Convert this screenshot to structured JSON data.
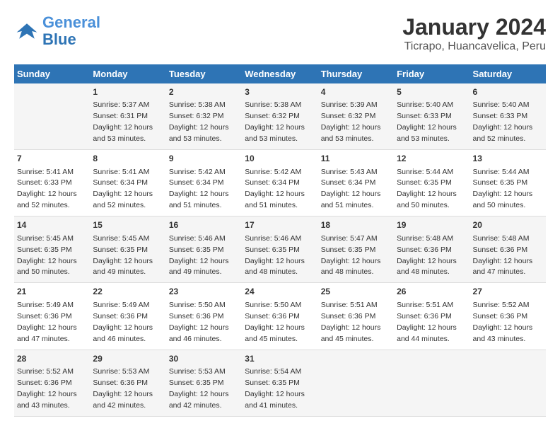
{
  "header": {
    "logo_line1": "General",
    "logo_line2": "Blue",
    "month_year": "January 2024",
    "location": "Ticrapo, Huancavelica, Peru"
  },
  "weekdays": [
    "Sunday",
    "Monday",
    "Tuesday",
    "Wednesday",
    "Thursday",
    "Friday",
    "Saturday"
  ],
  "weeks": [
    [
      {
        "day": "",
        "detail": ""
      },
      {
        "day": "1",
        "detail": "Sunrise: 5:37 AM\nSunset: 6:31 PM\nDaylight: 12 hours\nand 53 minutes."
      },
      {
        "day": "2",
        "detail": "Sunrise: 5:38 AM\nSunset: 6:32 PM\nDaylight: 12 hours\nand 53 minutes."
      },
      {
        "day": "3",
        "detail": "Sunrise: 5:38 AM\nSunset: 6:32 PM\nDaylight: 12 hours\nand 53 minutes."
      },
      {
        "day": "4",
        "detail": "Sunrise: 5:39 AM\nSunset: 6:32 PM\nDaylight: 12 hours\nand 53 minutes."
      },
      {
        "day": "5",
        "detail": "Sunrise: 5:40 AM\nSunset: 6:33 PM\nDaylight: 12 hours\nand 53 minutes."
      },
      {
        "day": "6",
        "detail": "Sunrise: 5:40 AM\nSunset: 6:33 PM\nDaylight: 12 hours\nand 52 minutes."
      }
    ],
    [
      {
        "day": "7",
        "detail": "Sunrise: 5:41 AM\nSunset: 6:33 PM\nDaylight: 12 hours\nand 52 minutes."
      },
      {
        "day": "8",
        "detail": "Sunrise: 5:41 AM\nSunset: 6:34 PM\nDaylight: 12 hours\nand 52 minutes."
      },
      {
        "day": "9",
        "detail": "Sunrise: 5:42 AM\nSunset: 6:34 PM\nDaylight: 12 hours\nand 51 minutes."
      },
      {
        "day": "10",
        "detail": "Sunrise: 5:42 AM\nSunset: 6:34 PM\nDaylight: 12 hours\nand 51 minutes."
      },
      {
        "day": "11",
        "detail": "Sunrise: 5:43 AM\nSunset: 6:34 PM\nDaylight: 12 hours\nand 51 minutes."
      },
      {
        "day": "12",
        "detail": "Sunrise: 5:44 AM\nSunset: 6:35 PM\nDaylight: 12 hours\nand 50 minutes."
      },
      {
        "day": "13",
        "detail": "Sunrise: 5:44 AM\nSunset: 6:35 PM\nDaylight: 12 hours\nand 50 minutes."
      }
    ],
    [
      {
        "day": "14",
        "detail": "Sunrise: 5:45 AM\nSunset: 6:35 PM\nDaylight: 12 hours\nand 50 minutes."
      },
      {
        "day": "15",
        "detail": "Sunrise: 5:45 AM\nSunset: 6:35 PM\nDaylight: 12 hours\nand 49 minutes."
      },
      {
        "day": "16",
        "detail": "Sunrise: 5:46 AM\nSunset: 6:35 PM\nDaylight: 12 hours\nand 49 minutes."
      },
      {
        "day": "17",
        "detail": "Sunrise: 5:46 AM\nSunset: 6:35 PM\nDaylight: 12 hours\nand 48 minutes."
      },
      {
        "day": "18",
        "detail": "Sunrise: 5:47 AM\nSunset: 6:35 PM\nDaylight: 12 hours\nand 48 minutes."
      },
      {
        "day": "19",
        "detail": "Sunrise: 5:48 AM\nSunset: 6:36 PM\nDaylight: 12 hours\nand 48 minutes."
      },
      {
        "day": "20",
        "detail": "Sunrise: 5:48 AM\nSunset: 6:36 PM\nDaylight: 12 hours\nand 47 minutes."
      }
    ],
    [
      {
        "day": "21",
        "detail": "Sunrise: 5:49 AM\nSunset: 6:36 PM\nDaylight: 12 hours\nand 47 minutes."
      },
      {
        "day": "22",
        "detail": "Sunrise: 5:49 AM\nSunset: 6:36 PM\nDaylight: 12 hours\nand 46 minutes."
      },
      {
        "day": "23",
        "detail": "Sunrise: 5:50 AM\nSunset: 6:36 PM\nDaylight: 12 hours\nand 46 minutes."
      },
      {
        "day": "24",
        "detail": "Sunrise: 5:50 AM\nSunset: 6:36 PM\nDaylight: 12 hours\nand 45 minutes."
      },
      {
        "day": "25",
        "detail": "Sunrise: 5:51 AM\nSunset: 6:36 PM\nDaylight: 12 hours\nand 45 minutes."
      },
      {
        "day": "26",
        "detail": "Sunrise: 5:51 AM\nSunset: 6:36 PM\nDaylight: 12 hours\nand 44 minutes."
      },
      {
        "day": "27",
        "detail": "Sunrise: 5:52 AM\nSunset: 6:36 PM\nDaylight: 12 hours\nand 43 minutes."
      }
    ],
    [
      {
        "day": "28",
        "detail": "Sunrise: 5:52 AM\nSunset: 6:36 PM\nDaylight: 12 hours\nand 43 minutes."
      },
      {
        "day": "29",
        "detail": "Sunrise: 5:53 AM\nSunset: 6:36 PM\nDaylight: 12 hours\nand 42 minutes."
      },
      {
        "day": "30",
        "detail": "Sunrise: 5:53 AM\nSunset: 6:35 PM\nDaylight: 12 hours\nand 42 minutes."
      },
      {
        "day": "31",
        "detail": "Sunrise: 5:54 AM\nSunset: 6:35 PM\nDaylight: 12 hours\nand 41 minutes."
      },
      {
        "day": "",
        "detail": ""
      },
      {
        "day": "",
        "detail": ""
      },
      {
        "day": "",
        "detail": ""
      }
    ]
  ]
}
